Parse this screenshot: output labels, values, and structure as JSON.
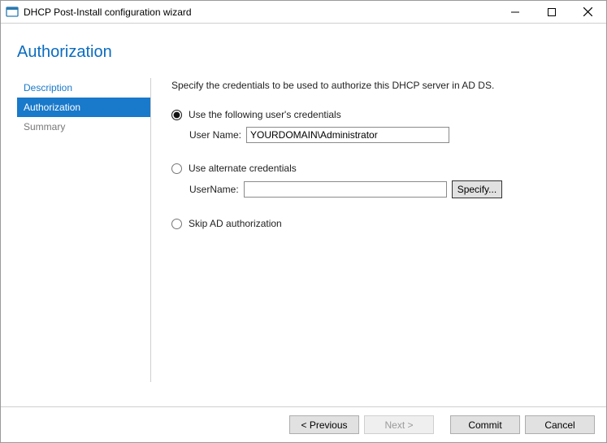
{
  "window": {
    "title": "DHCP Post-Install configuration wizard"
  },
  "page": {
    "header": "Authorization"
  },
  "sidebar": {
    "items": [
      {
        "label": "Description",
        "state": "link"
      },
      {
        "label": "Authorization",
        "state": "active"
      },
      {
        "label": "Summary",
        "state": "disabled"
      }
    ]
  },
  "content": {
    "intro": "Specify the credentials to be used to authorize this DHCP server in AD DS.",
    "option1": {
      "label": "Use the following user's credentials",
      "usernameLabel": "User Name:",
      "usernameValue": "YOURDOMAIN\\Administrator"
    },
    "option2": {
      "label": "Use alternate credentials",
      "usernameLabel": "UserName:",
      "usernameValue": "",
      "specifyLabel": "Specify..."
    },
    "option3": {
      "label": "Skip AD authorization"
    }
  },
  "footer": {
    "previous": "< Previous",
    "next": "Next >",
    "commit": "Commit",
    "cancel": "Cancel"
  }
}
